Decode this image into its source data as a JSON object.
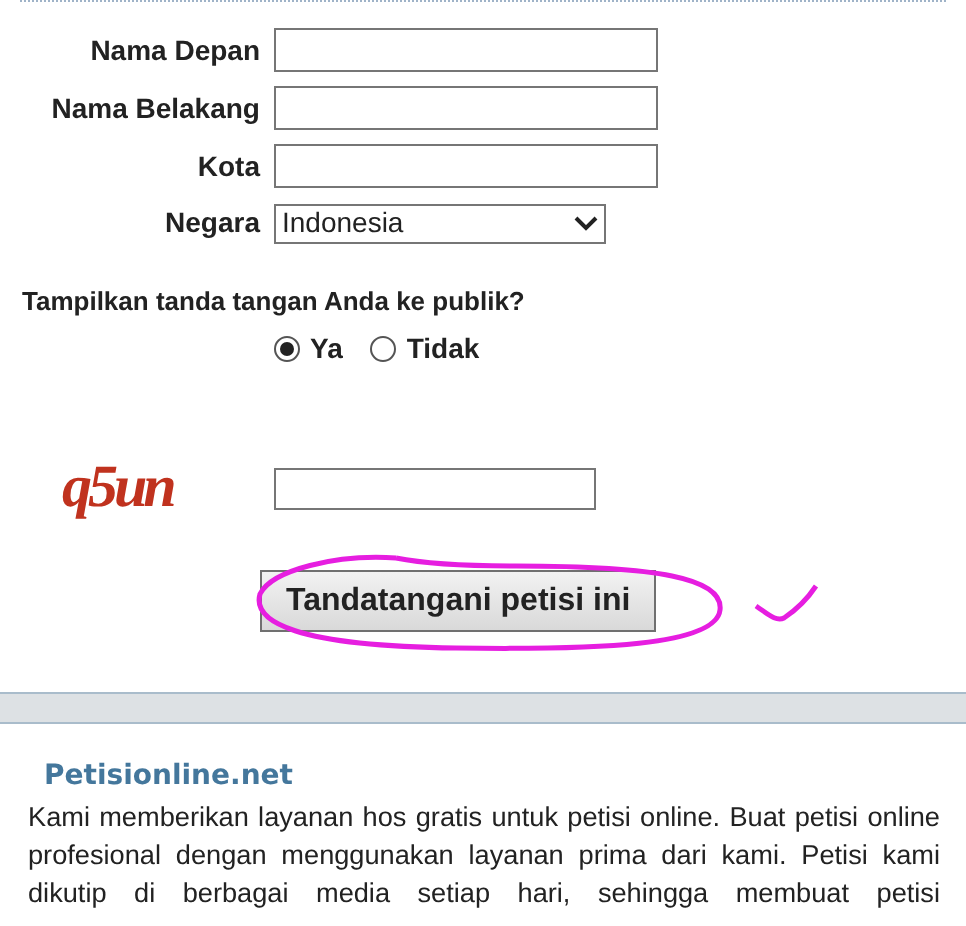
{
  "form": {
    "fields": [
      {
        "kind": "text",
        "label": "Nama Depan"
      },
      {
        "kind": "text",
        "label": "Nama Belakang"
      },
      {
        "kind": "text",
        "label": "Kota"
      },
      {
        "kind": "select",
        "label": "Negara",
        "value": "Indonesia"
      }
    ],
    "question": "Tampilkan tanda tangan Anda ke publik?",
    "options": [
      {
        "label": "Ya",
        "selected": true
      },
      {
        "label": "Tidak",
        "selected": false
      }
    ],
    "captcha": {
      "text": "q5un"
    },
    "submit": "Tandatangani petisi ini"
  },
  "about": {
    "title": "Petisionline.net",
    "text": "Kami memberikan layanan hos gratis untuk petisi online. Buat petisi online profesional dengan menggunakan layanan prima dari kami. Petisi kami dikutip di berbagai media setiap hari, sehingga membuat petisi"
  }
}
